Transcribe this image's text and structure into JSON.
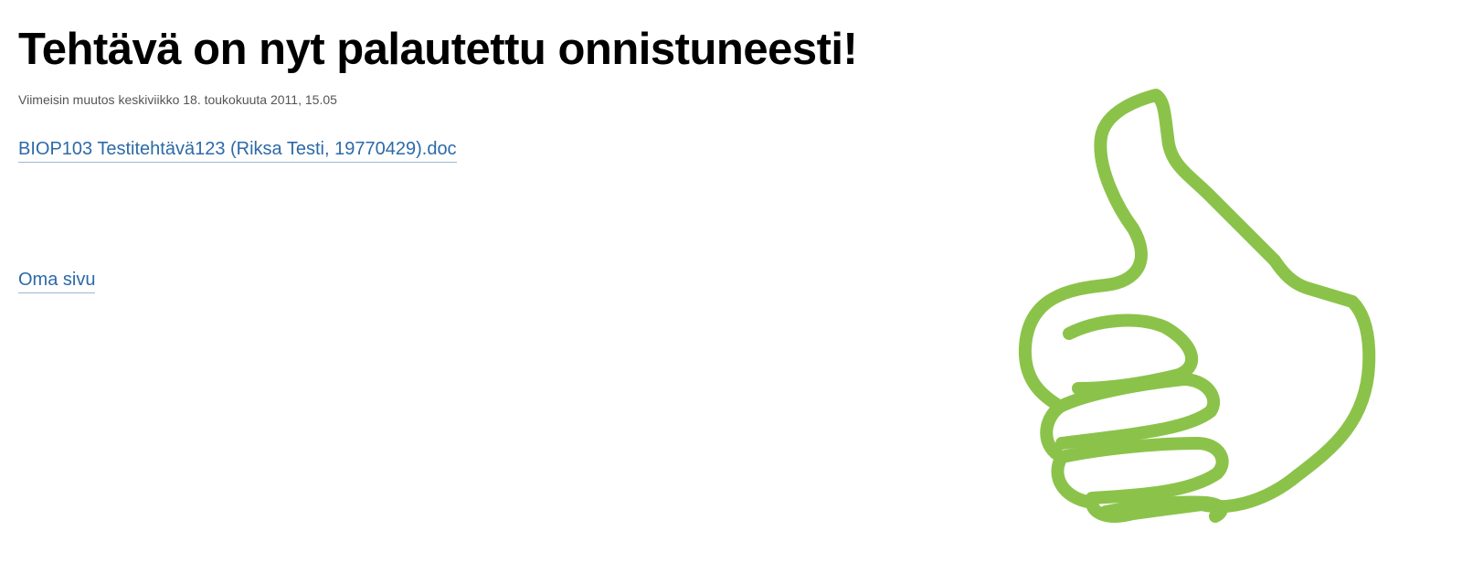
{
  "page": {
    "title": "Tehtävä on nyt palautettu onnistuneesti!",
    "last_modified": "Viimeisin muutos keskiviikko 18. toukokuuta 2011, 15.05"
  },
  "links": {
    "file_name": "BIOP103 Testitehtävä123 (Riksa Testi, 19770429).doc",
    "home": "Oma sivu"
  },
  "illustration": {
    "icon": "thumbs-up-icon",
    "color": "#8bc34a"
  },
  "colors": {
    "link": "#2c6aa8",
    "title": "#000000",
    "meta": "#555555"
  }
}
